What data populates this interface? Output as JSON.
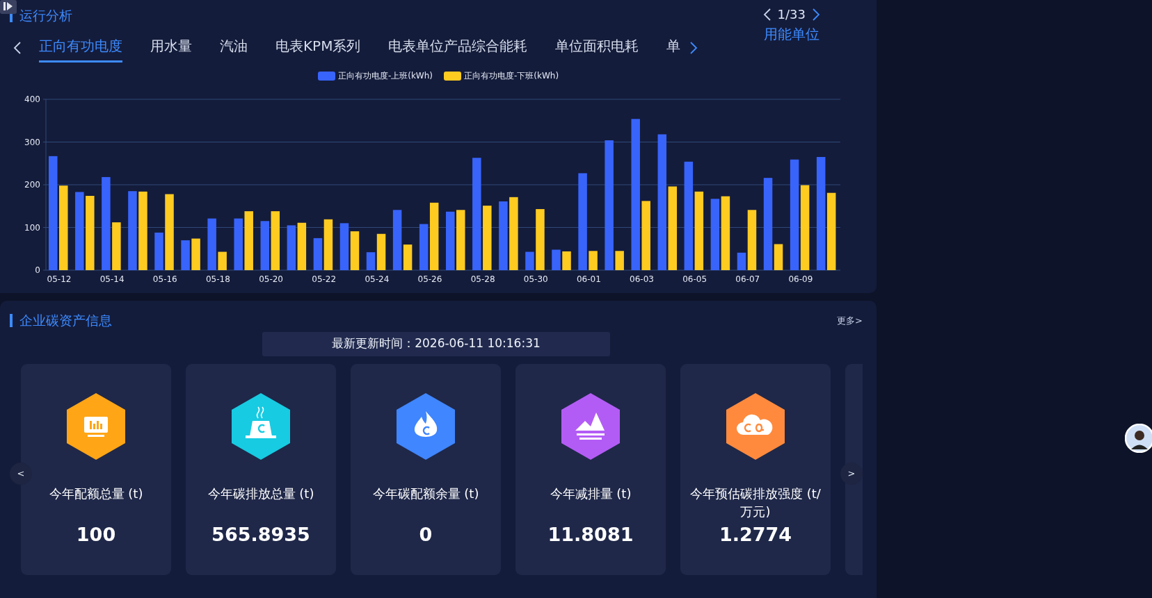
{
  "run_analysis": {
    "title": "运行分析",
    "tabs": [
      {
        "label": "正向有功电度",
        "selected": true
      },
      {
        "label": "用水量",
        "selected": false
      },
      {
        "label": "汽油",
        "selected": false
      },
      {
        "label": "电表KPM系列",
        "selected": false
      },
      {
        "label": "电表单位产品综合能耗",
        "selected": false
      },
      {
        "label": "单位面积电耗",
        "selected": false
      },
      {
        "label": "单",
        "selected": false
      }
    ],
    "pager": {
      "text": "1/33",
      "link": "用能单位"
    },
    "chart_data": {
      "type": "bar",
      "grid": true,
      "categories": [
        "05-12",
        null,
        "05-14",
        null,
        "05-16",
        null,
        "05-18",
        null,
        "05-20",
        null,
        "05-22",
        null,
        "05-24",
        null,
        "05-26",
        null,
        "05-28",
        null,
        "05-30",
        null,
        "06-01",
        null,
        "06-03",
        null,
        "06-05",
        null,
        "06-07",
        null,
        "06-09",
        null
      ],
      "series": [
        {
          "name": "正向有功电度-上班(kWh)",
          "color": "#3864fc",
          "values": [
            267,
            183,
            218,
            185,
            88,
            70,
            121,
            121,
            115,
            105,
            75,
            110,
            42,
            141,
            108,
            137,
            263,
            161,
            43,
            48,
            227,
            304,
            354,
            318,
            254,
            167,
            41,
            216,
            259,
            265
          ]
        },
        {
          "name": "正向有功电度-下班(kWh)",
          "color": "#fecb21",
          "values": [
            198,
            174,
            112,
            184,
            178,
            74,
            43,
            138,
            138,
            111,
            119,
            91,
            85,
            60,
            158,
            141,
            151,
            171,
            143,
            44,
            45,
            45,
            162,
            196,
            184,
            173,
            141,
            61,
            199,
            181
          ]
        }
      ],
      "ylim": [
        0,
        400
      ],
      "yticks": [
        0,
        100,
        200,
        300,
        400
      ]
    }
  },
  "carbon_assets": {
    "title": "企业碳资产信息",
    "more": "更多>",
    "update_time": "最新更新时间：2026-06-11 10:16:31",
    "prev": "<",
    "next": ">",
    "cards": [
      {
        "kind": "stat",
        "label": "今年配额总量 (t)",
        "value": "100",
        "color": "#ffa516"
      },
      {
        "kind": "stat",
        "label": "今年碳排放总量 (t)",
        "value": "565.8935",
        "color": "#17cbe2"
      },
      {
        "kind": "stat",
        "label": "今年碳配额余量 (t)",
        "value": "0",
        "color": "#3f86ff"
      },
      {
        "kind": "stat",
        "label": "今年减排量 (t)",
        "value": "11.8081",
        "color": "#b35cf5"
      },
      {
        "kind": "stat",
        "label": "今年预估碳排放强度 (t/万元)",
        "value": "1.2774",
        "color": "#ff8a3d"
      },
      {
        "kind": "clipped"
      }
    ]
  }
}
